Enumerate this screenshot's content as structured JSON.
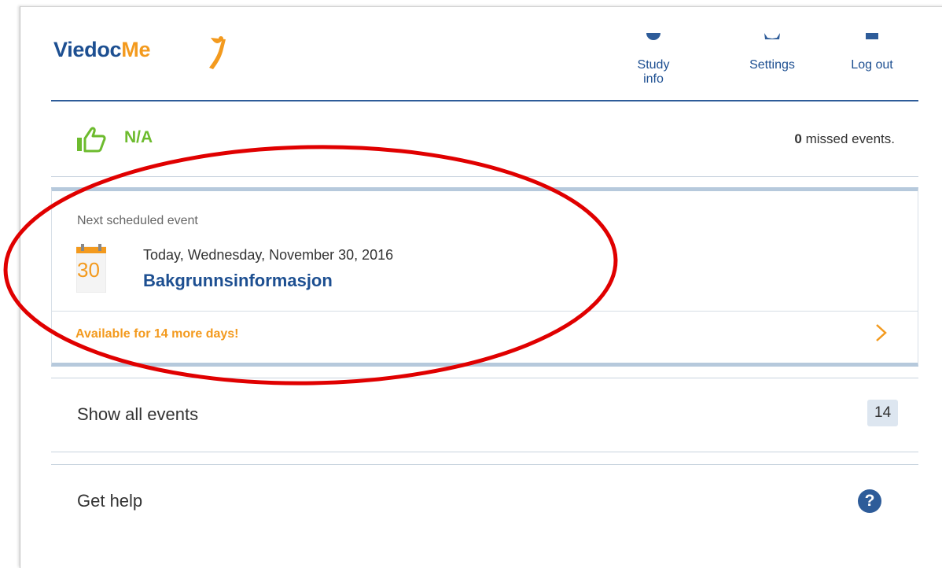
{
  "header": {
    "logo_part1": "Viedoc",
    "logo_part2": "Me",
    "nav": [
      {
        "label": "Study info",
        "icon": "info-icon"
      },
      {
        "label": "Settings",
        "icon": "gear-icon"
      },
      {
        "label": "Log out",
        "icon": "logout-icon"
      }
    ]
  },
  "status": {
    "value": "N/A",
    "icon": "thumbs-up-icon",
    "missed_count": "0",
    "missed_suffix": " missed events."
  },
  "next_event": {
    "label": "Next scheduled event",
    "calendar_day": "30",
    "date_text": "Today, Wednesday, November 30, 2016",
    "title": "Bakgrunnsinformasjon",
    "availability": "Available for 14 more days!"
  },
  "show_all": {
    "label": "Show all events",
    "count": "14"
  },
  "help": {
    "label": "Get help",
    "icon_glyph": "?"
  },
  "colors": {
    "brand_blue": "#1d4f91",
    "accent_orange": "#f39a1e",
    "status_green": "#6dbb2e",
    "annotation_red": "#e00000"
  }
}
